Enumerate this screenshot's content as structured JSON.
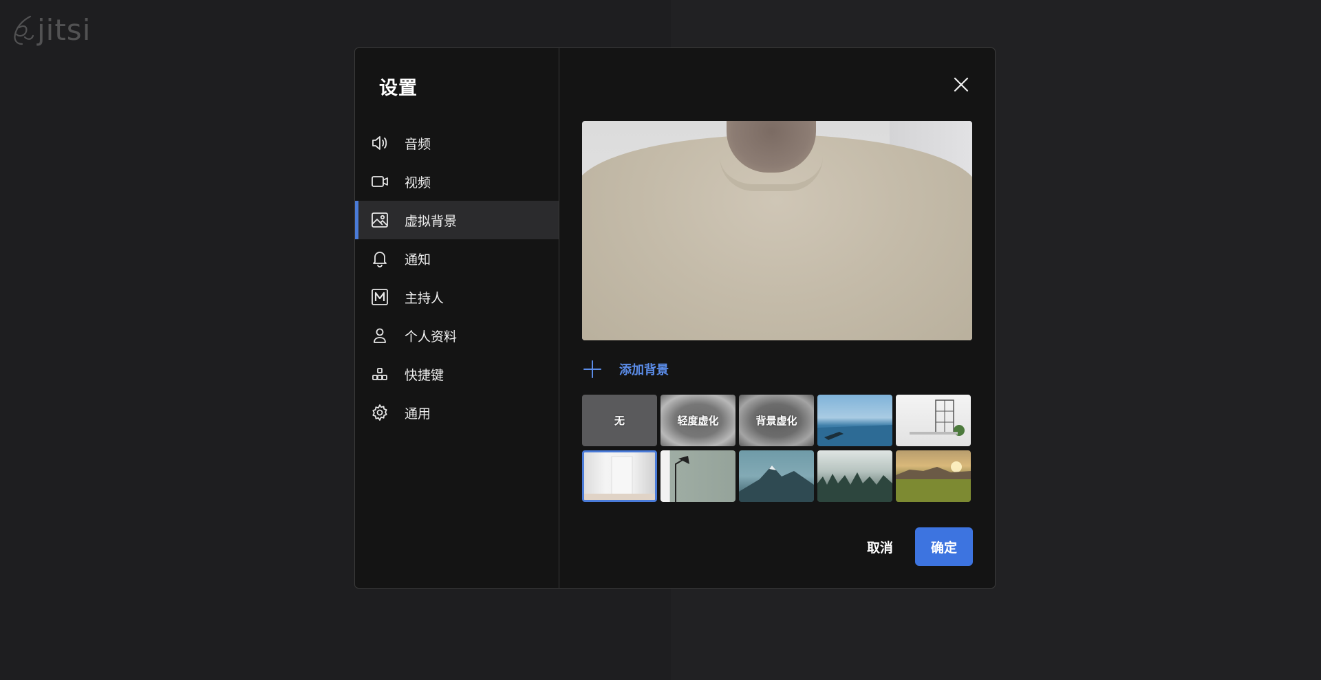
{
  "app": {
    "logo_text": "jitsi"
  },
  "dialog": {
    "title": "设置"
  },
  "sidebar": {
    "items": [
      {
        "label": "音频",
        "icon": "speaker-icon",
        "active": false
      },
      {
        "label": "视频",
        "icon": "video-camera-icon",
        "active": false
      },
      {
        "label": "虚拟背景",
        "icon": "image-icon",
        "active": true
      },
      {
        "label": "通知",
        "icon": "bell-icon",
        "active": false
      },
      {
        "label": "主持人",
        "icon": "moderator-m-icon",
        "active": false
      },
      {
        "label": "个人资料",
        "icon": "user-icon",
        "active": false
      },
      {
        "label": "快捷键",
        "icon": "shortcuts-icon",
        "active": false
      },
      {
        "label": "通用",
        "icon": "gear-icon",
        "active": false
      }
    ]
  },
  "main": {
    "add_background_label": "添加背景",
    "backgrounds": [
      {
        "label": "无",
        "kind": "none"
      },
      {
        "label": "轻度虚化",
        "kind": "slight-blur"
      },
      {
        "label": "背景虚化",
        "kind": "blur"
      },
      {
        "label": "",
        "kind": "image-beach"
      },
      {
        "label": "",
        "kind": "image-room"
      },
      {
        "label": "",
        "kind": "image-door",
        "selected": true
      },
      {
        "label": "",
        "kind": "image-lamp"
      },
      {
        "label": "",
        "kind": "image-mountain"
      },
      {
        "label": "",
        "kind": "image-forest"
      },
      {
        "label": "",
        "kind": "image-field"
      }
    ]
  },
  "footer": {
    "cancel_label": "取消",
    "ok_label": "确定"
  },
  "colors": {
    "accent": "#3d74e0",
    "link": "#5b8ce8",
    "active_bar": "#4a7bd8"
  }
}
